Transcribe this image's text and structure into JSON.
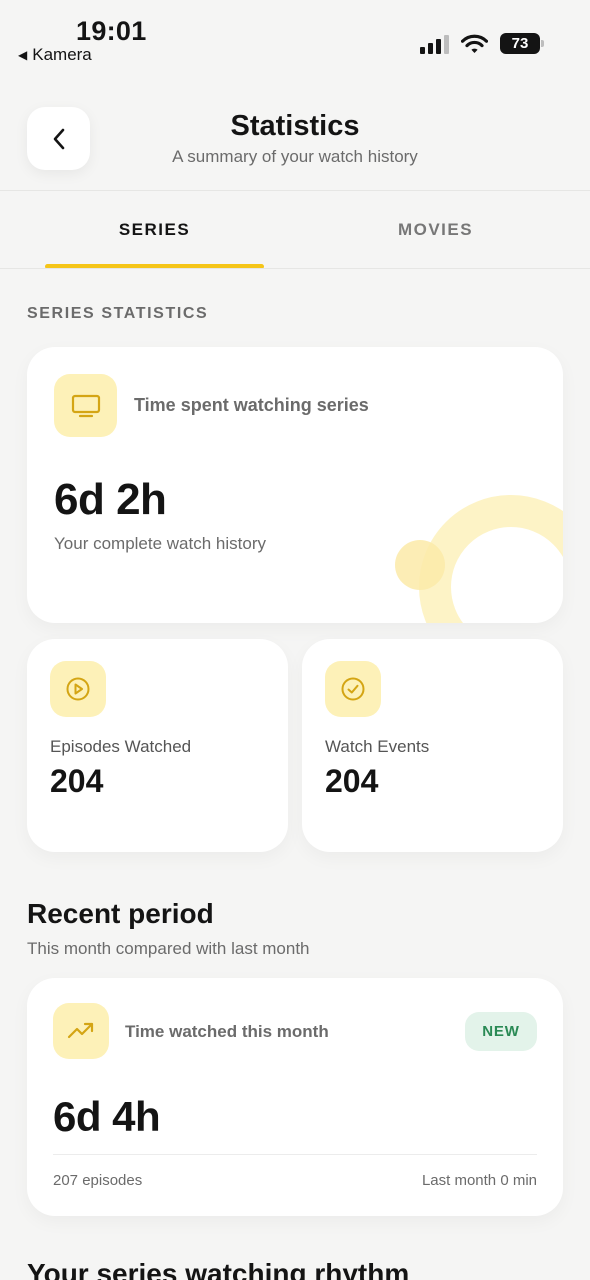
{
  "status_bar": {
    "time": "19:01",
    "back_app": "Kamera",
    "battery": "73"
  },
  "header": {
    "title": "Statistics",
    "subtitle": "A summary of your watch history"
  },
  "tabs": [
    {
      "label": "SERIES",
      "active": true
    },
    {
      "label": "MOVIES",
      "active": false
    }
  ],
  "section_label": "SERIES STATISTICS",
  "main_card": {
    "icon": "tv-icon",
    "label": "Time spent watching series",
    "value": "6d 2h",
    "caption": "Your complete watch history"
  },
  "small_cards": [
    {
      "icon": "play-circle-icon",
      "label": "Episodes Watched",
      "value": "204"
    },
    {
      "icon": "check-circle-icon",
      "label": "Watch Events",
      "value": "204"
    }
  ],
  "recent": {
    "title": "Recent period",
    "subtitle": "This month compared with last month",
    "card": {
      "icon": "trending-up-icon",
      "label": "Time watched this month",
      "badge": "NEW",
      "value": "6d 4h",
      "episodes": "207 episodes",
      "last_month": "Last month 0 min"
    }
  },
  "rhythm": {
    "title": "Your series watching rhythm"
  },
  "colors": {
    "accent": "#f5c518",
    "icon_bg": "#fdf1b8",
    "icon_stroke": "#d4a514",
    "badge_bg": "#e3f3ea",
    "badge_text": "#2a8a55"
  }
}
